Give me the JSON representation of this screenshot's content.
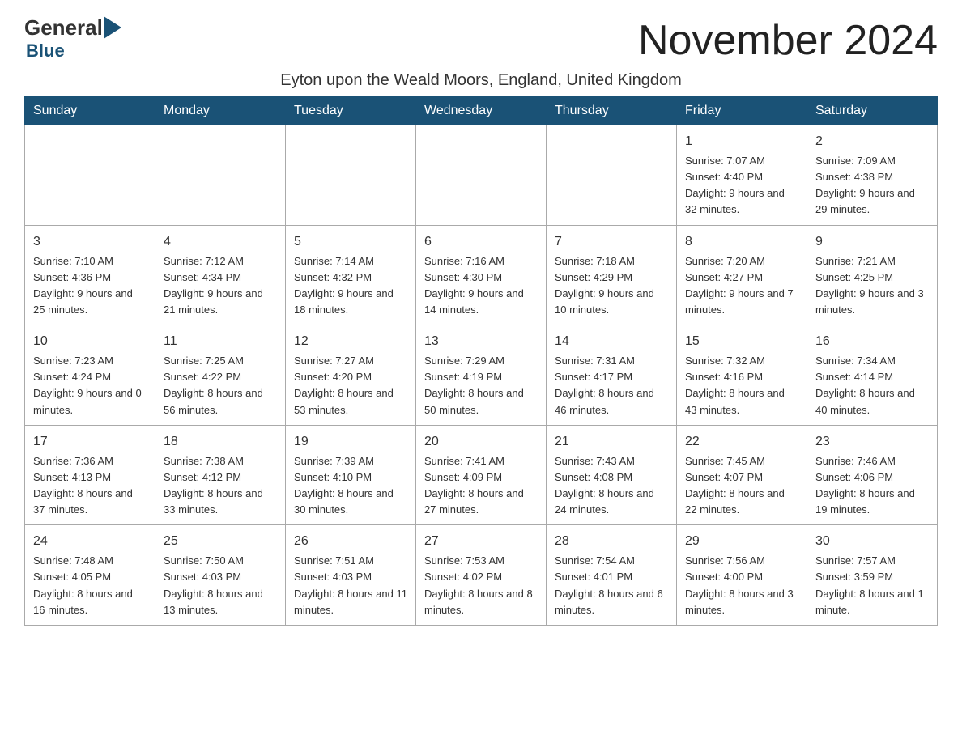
{
  "header": {
    "logo_general": "General",
    "logo_blue": "Blue",
    "month_title": "November 2024",
    "location": "Eyton upon the Weald Moors, England, United Kingdom"
  },
  "calendar": {
    "days_of_week": [
      "Sunday",
      "Monday",
      "Tuesday",
      "Wednesday",
      "Thursday",
      "Friday",
      "Saturday"
    ],
    "weeks": [
      [
        {
          "day": "",
          "info": ""
        },
        {
          "day": "",
          "info": ""
        },
        {
          "day": "",
          "info": ""
        },
        {
          "day": "",
          "info": ""
        },
        {
          "day": "",
          "info": ""
        },
        {
          "day": "1",
          "info": "Sunrise: 7:07 AM\nSunset: 4:40 PM\nDaylight: 9 hours and 32 minutes."
        },
        {
          "day": "2",
          "info": "Sunrise: 7:09 AM\nSunset: 4:38 PM\nDaylight: 9 hours and 29 minutes."
        }
      ],
      [
        {
          "day": "3",
          "info": "Sunrise: 7:10 AM\nSunset: 4:36 PM\nDaylight: 9 hours and 25 minutes."
        },
        {
          "day": "4",
          "info": "Sunrise: 7:12 AM\nSunset: 4:34 PM\nDaylight: 9 hours and 21 minutes."
        },
        {
          "day": "5",
          "info": "Sunrise: 7:14 AM\nSunset: 4:32 PM\nDaylight: 9 hours and 18 minutes."
        },
        {
          "day": "6",
          "info": "Sunrise: 7:16 AM\nSunset: 4:30 PM\nDaylight: 9 hours and 14 minutes."
        },
        {
          "day": "7",
          "info": "Sunrise: 7:18 AM\nSunset: 4:29 PM\nDaylight: 9 hours and 10 minutes."
        },
        {
          "day": "8",
          "info": "Sunrise: 7:20 AM\nSunset: 4:27 PM\nDaylight: 9 hours and 7 minutes."
        },
        {
          "day": "9",
          "info": "Sunrise: 7:21 AM\nSunset: 4:25 PM\nDaylight: 9 hours and 3 minutes."
        }
      ],
      [
        {
          "day": "10",
          "info": "Sunrise: 7:23 AM\nSunset: 4:24 PM\nDaylight: 9 hours and 0 minutes."
        },
        {
          "day": "11",
          "info": "Sunrise: 7:25 AM\nSunset: 4:22 PM\nDaylight: 8 hours and 56 minutes."
        },
        {
          "day": "12",
          "info": "Sunrise: 7:27 AM\nSunset: 4:20 PM\nDaylight: 8 hours and 53 minutes."
        },
        {
          "day": "13",
          "info": "Sunrise: 7:29 AM\nSunset: 4:19 PM\nDaylight: 8 hours and 50 minutes."
        },
        {
          "day": "14",
          "info": "Sunrise: 7:31 AM\nSunset: 4:17 PM\nDaylight: 8 hours and 46 minutes."
        },
        {
          "day": "15",
          "info": "Sunrise: 7:32 AM\nSunset: 4:16 PM\nDaylight: 8 hours and 43 minutes."
        },
        {
          "day": "16",
          "info": "Sunrise: 7:34 AM\nSunset: 4:14 PM\nDaylight: 8 hours and 40 minutes."
        }
      ],
      [
        {
          "day": "17",
          "info": "Sunrise: 7:36 AM\nSunset: 4:13 PM\nDaylight: 8 hours and 37 minutes."
        },
        {
          "day": "18",
          "info": "Sunrise: 7:38 AM\nSunset: 4:12 PM\nDaylight: 8 hours and 33 minutes."
        },
        {
          "day": "19",
          "info": "Sunrise: 7:39 AM\nSunset: 4:10 PM\nDaylight: 8 hours and 30 minutes."
        },
        {
          "day": "20",
          "info": "Sunrise: 7:41 AM\nSunset: 4:09 PM\nDaylight: 8 hours and 27 minutes."
        },
        {
          "day": "21",
          "info": "Sunrise: 7:43 AM\nSunset: 4:08 PM\nDaylight: 8 hours and 24 minutes."
        },
        {
          "day": "22",
          "info": "Sunrise: 7:45 AM\nSunset: 4:07 PM\nDaylight: 8 hours and 22 minutes."
        },
        {
          "day": "23",
          "info": "Sunrise: 7:46 AM\nSunset: 4:06 PM\nDaylight: 8 hours and 19 minutes."
        }
      ],
      [
        {
          "day": "24",
          "info": "Sunrise: 7:48 AM\nSunset: 4:05 PM\nDaylight: 8 hours and 16 minutes."
        },
        {
          "day": "25",
          "info": "Sunrise: 7:50 AM\nSunset: 4:03 PM\nDaylight: 8 hours and 13 minutes."
        },
        {
          "day": "26",
          "info": "Sunrise: 7:51 AM\nSunset: 4:03 PM\nDaylight: 8 hours and 11 minutes."
        },
        {
          "day": "27",
          "info": "Sunrise: 7:53 AM\nSunset: 4:02 PM\nDaylight: 8 hours and 8 minutes."
        },
        {
          "day": "28",
          "info": "Sunrise: 7:54 AM\nSunset: 4:01 PM\nDaylight: 8 hours and 6 minutes."
        },
        {
          "day": "29",
          "info": "Sunrise: 7:56 AM\nSunset: 4:00 PM\nDaylight: 8 hours and 3 minutes."
        },
        {
          "day": "30",
          "info": "Sunrise: 7:57 AM\nSunset: 3:59 PM\nDaylight: 8 hours and 1 minute."
        }
      ]
    ]
  }
}
